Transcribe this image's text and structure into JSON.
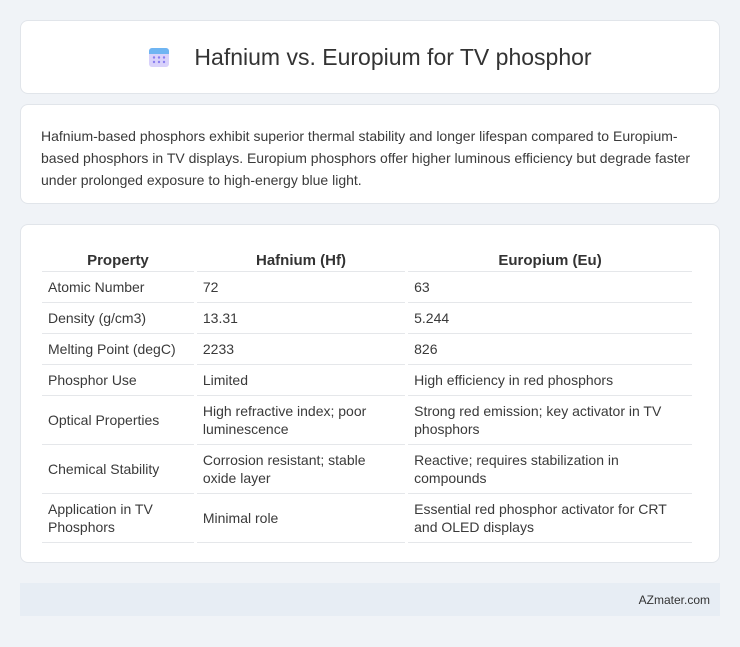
{
  "header": {
    "title": "Hafnium vs. Europium for TV phosphor",
    "icon": "calendar-icon"
  },
  "summary": {
    "text": "Hafnium-based phosphors exhibit superior thermal stability and longer lifespan compared to Europium-based phosphors in TV displays. Europium phosphors offer higher luminous efficiency but degrade faster under prolonged exposure to high-energy blue light."
  },
  "table": {
    "headers": [
      "Property",
      "Hafnium (Hf)",
      "Europium (Eu)"
    ],
    "rows": [
      [
        "Atomic Number",
        "72",
        "63"
      ],
      [
        "Density (g/cm3)",
        "13.31",
        "5.244"
      ],
      [
        "Melting Point (degC)",
        "2233",
        "826"
      ],
      [
        "Phosphor Use",
        "Limited",
        "High efficiency in red phosphors"
      ],
      [
        "Optical Properties",
        "High refractive index; poor luminescence",
        "Strong red emission; key activator in TV phosphors"
      ],
      [
        "Chemical Stability",
        "Corrosion resistant; stable oxide layer",
        "Reactive; requires stabilization in compounds"
      ],
      [
        "Application in TV Phosphors",
        "Minimal role",
        "Essential red phosphor activator for CRT and OLED displays"
      ]
    ]
  },
  "footer": {
    "text": "AZmater.com"
  },
  "colors": {
    "background": "#f0f3f7",
    "card": "#ffffff",
    "footer_bg": "#e7edf4",
    "icon_accent": "#8a7ff0"
  }
}
